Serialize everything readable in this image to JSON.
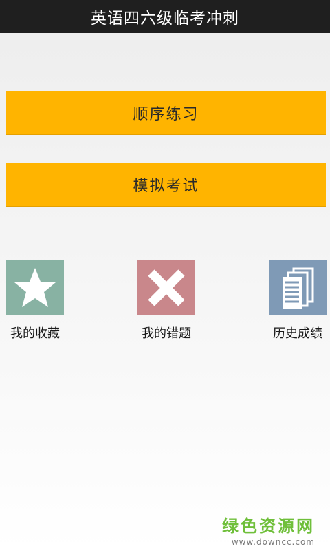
{
  "header": {
    "title": "英语四六级临考冲刺"
  },
  "main": {
    "buttons": [
      {
        "label": "顺序练习"
      },
      {
        "label": "模拟考试"
      }
    ],
    "tiles": [
      {
        "label": "我的收藏",
        "icon": "star-icon",
        "color": "#88b2a3"
      },
      {
        "label": "我的错题",
        "icon": "cross-icon",
        "color": "#c9878b"
      },
      {
        "label": "历史成绩",
        "icon": "documents-icon",
        "color": "#7f9ab6"
      }
    ]
  },
  "watermark": {
    "name": "绿色资源网",
    "url": "www.downcc.com"
  },
  "colors": {
    "accent": "#ffb400",
    "titlebar": "#1f1f1f"
  }
}
